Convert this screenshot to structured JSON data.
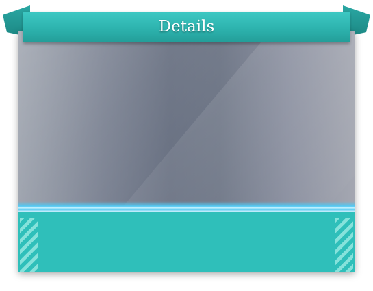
{
  "header": {
    "title": "Details"
  },
  "colors": {
    "ribbon": "#2db3ae",
    "info_bar": "#2fbfba",
    "glow": "#53c8f2",
    "image_placeholder": "#7c8393"
  }
}
